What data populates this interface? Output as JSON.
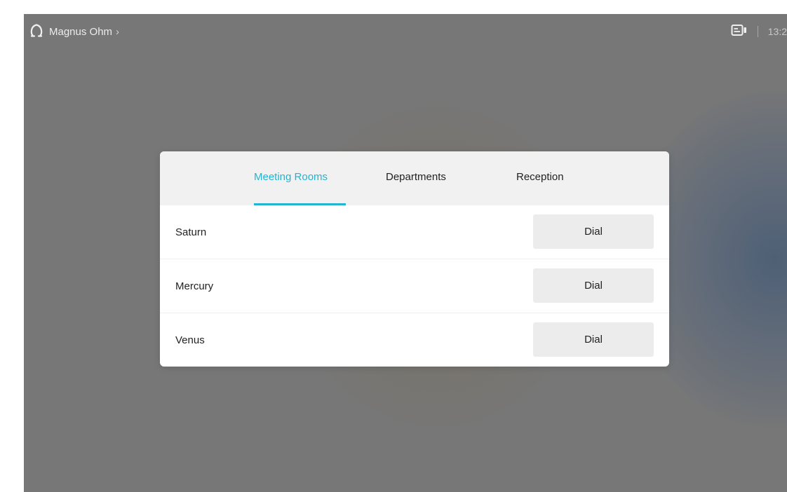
{
  "user": {
    "name": "Magnus Ohm",
    "chevron": "›"
  },
  "status": {
    "clock": "13:2"
  },
  "icons": {
    "user": "person-outline-icon",
    "device": "video-device-icon"
  },
  "tabs": [
    {
      "label": "Meeting Rooms",
      "active": true
    },
    {
      "label": "Departments",
      "active": false
    },
    {
      "label": "Reception",
      "active": false
    }
  ],
  "rooms": [
    {
      "name": "Saturn",
      "action": "Dial"
    },
    {
      "name": "Mercury",
      "action": "Dial"
    },
    {
      "name": "Venus",
      "action": "Dial"
    }
  ],
  "colors": {
    "accent": "#23b4d1",
    "background": "#777777",
    "panel": "#ffffff",
    "tab_bar": "#f1f1f1",
    "dial_button": "#ececec"
  }
}
